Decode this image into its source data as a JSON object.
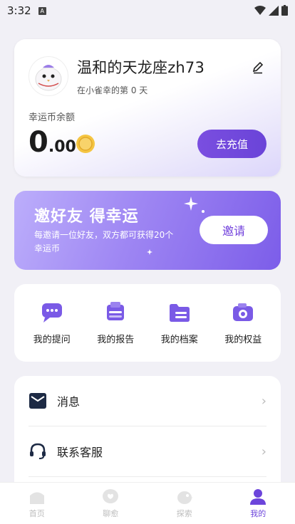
{
  "status_bar": {
    "time": "3:32"
  },
  "profile": {
    "nickname": "温和的天龙座zh73",
    "days_text": "在小雀幸的第 0 天",
    "balance_label": "幸运币余额",
    "balance_int": "0",
    "balance_dec": ".00",
    "recharge_label": "去充值"
  },
  "invite": {
    "title": "邀好友 得幸运",
    "desc": "每邀请一位好友，双方都可获得20个幸运币",
    "button_label": "邀请"
  },
  "menu": [
    {
      "label": "我的提问",
      "icon": "chat-bubble-icon"
    },
    {
      "label": "我的报告",
      "icon": "report-stack-icon"
    },
    {
      "label": "我的档案",
      "icon": "folder-icon"
    },
    {
      "label": "我的权益",
      "icon": "camera-benefit-icon"
    }
  ],
  "list": [
    {
      "label": "消息",
      "icon": "mail-icon"
    },
    {
      "label": "联系客服",
      "icon": "headset-icon"
    }
  ],
  "tabs": [
    {
      "label": "首页",
      "active": false
    },
    {
      "label": "聊愈",
      "active": false
    },
    {
      "label": "探索",
      "active": false
    },
    {
      "label": "我的",
      "active": true
    }
  ],
  "colors": {
    "accent": "#6c45db",
    "banner_start": "#bcaefb",
    "banner_end": "#7c5de9"
  }
}
